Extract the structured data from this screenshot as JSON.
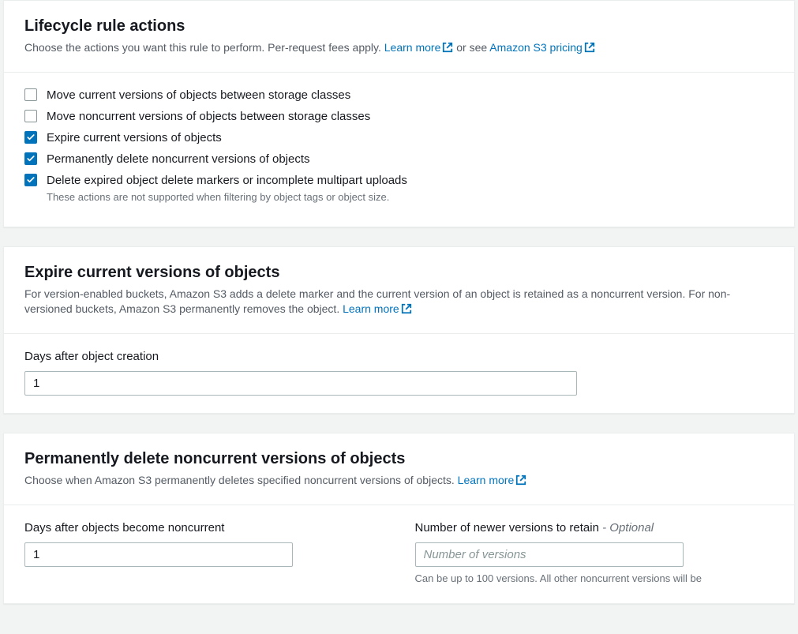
{
  "section1": {
    "title": "Lifecycle rule actions",
    "subtitle_pre": "Choose the actions you want this rule to perform. Per-request fees apply. ",
    "learn_more": "Learn more",
    "subtitle_mid": " or see ",
    "pricing_link": "Amazon S3 pricing",
    "actions": [
      {
        "label": "Move current versions of objects between storage classes",
        "checked": false
      },
      {
        "label": "Move noncurrent versions of objects between storage classes",
        "checked": false
      },
      {
        "label": "Expire current versions of objects",
        "checked": true
      },
      {
        "label": "Permanently delete noncurrent versions of objects",
        "checked": true
      },
      {
        "label": "Delete expired object delete markers or incomplete multipart uploads",
        "checked": true,
        "sub": "These actions are not supported when filtering by object tags or object size."
      }
    ]
  },
  "section2": {
    "title": "Expire current versions of objects",
    "subtitle_pre": "For version-enabled buckets, Amazon S3 adds a delete marker and the current version of an object is retained as a noncurrent version. For non-versioned buckets, Amazon S3 permanently removes the object. ",
    "learn_more": "Learn more",
    "field_label": "Days after object creation",
    "field_value": "1"
  },
  "section3": {
    "title": "Permanently delete noncurrent versions of objects",
    "subtitle_pre": "Choose when Amazon S3 permanently deletes specified noncurrent versions of objects. ",
    "learn_more": "Learn more",
    "left": {
      "label": "Days after objects become noncurrent",
      "value": "1"
    },
    "right": {
      "label": "Number of newer versions to retain ",
      "optional": "- Optional",
      "placeholder": "Number of versions",
      "hint": "Can be up to 100 versions. All other noncurrent versions will be"
    }
  }
}
